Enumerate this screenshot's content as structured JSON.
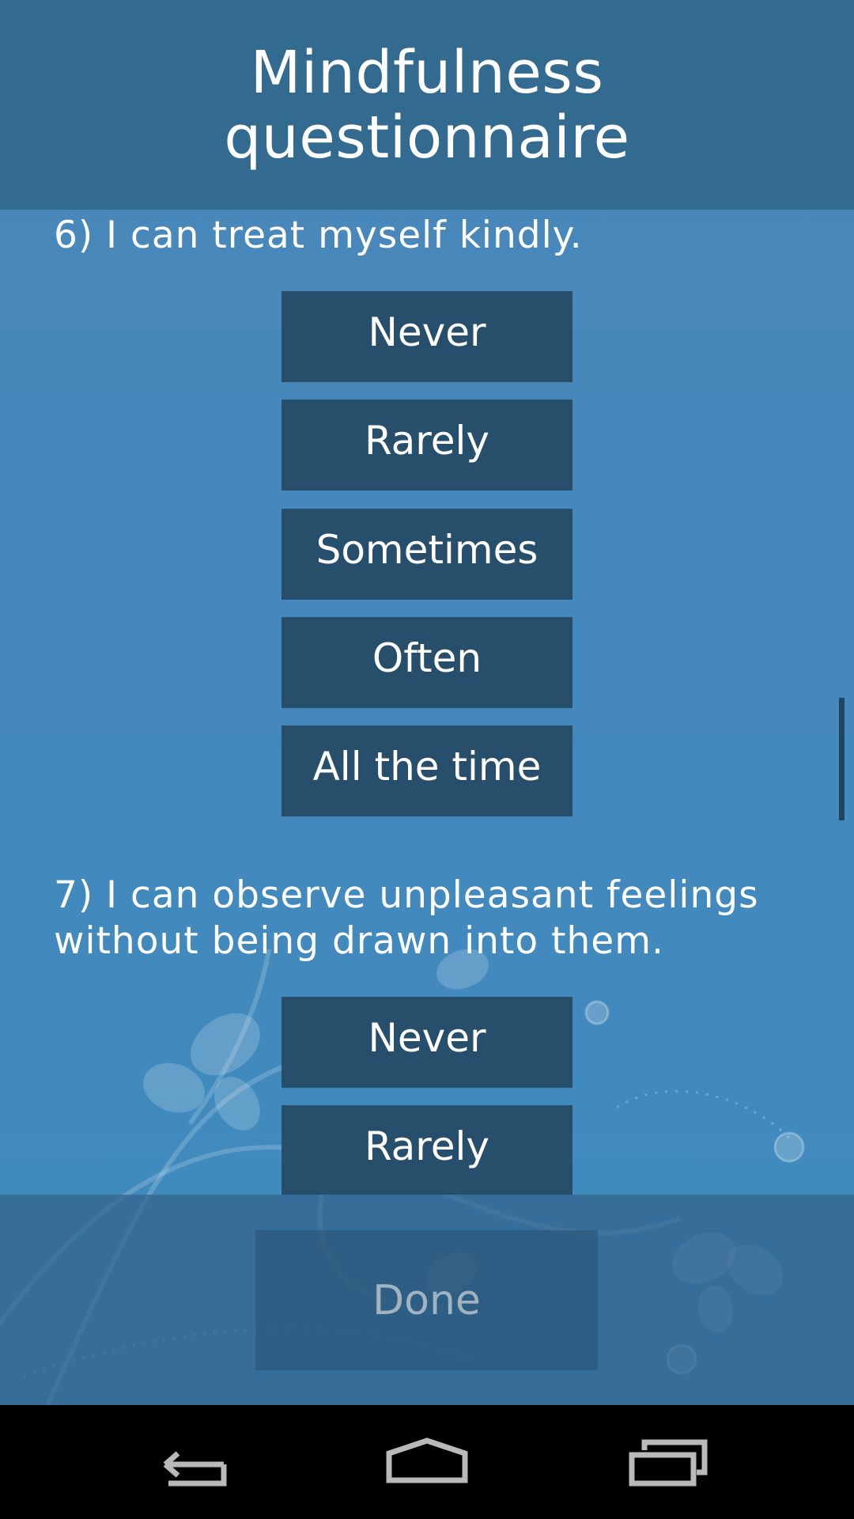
{
  "header": {
    "title": "Mindfulness questionnaire"
  },
  "questions": [
    {
      "text": "6) I can treat myself kindly.",
      "options": [
        "Never",
        "Rarely",
        "Sometimes",
        "Often",
        "All the time"
      ]
    },
    {
      "text": "7) I can observe unpleasant feelings without being drawn into them.",
      "options": [
        "Never",
        "Rarely"
      ]
    }
  ],
  "footer": {
    "done_label": "Done"
  },
  "colors": {
    "header": "#336a8f",
    "button": "#274f6b",
    "background": "#4488bd"
  },
  "icons": {
    "nav": [
      "back-icon",
      "home-icon",
      "recent-apps-icon"
    ]
  }
}
